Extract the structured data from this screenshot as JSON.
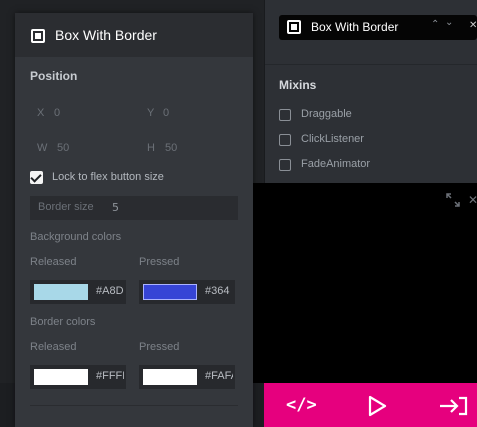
{
  "colors": {
    "accent_pink": "#e6007e",
    "released_bg": "#a8d8e8",
    "pressed_bg": "#3644d6",
    "released_border": "#ffffff",
    "pressed_border": "#ffffff"
  },
  "header": {
    "title": "Box With Border",
    "icon": "square-widget-icon",
    "chevron_up": "⌃",
    "chevron_down": "⌄",
    "close": "✕"
  },
  "mixins": {
    "title": "Mixins",
    "items": [
      {
        "label": "Draggable",
        "checked": false
      },
      {
        "label": "ClickListener",
        "checked": false
      },
      {
        "label": "FadeAnimator",
        "checked": false
      }
    ]
  },
  "panel": {
    "title": "Box With Border",
    "position": {
      "title": "Position",
      "x_label": "X",
      "x_value": "0",
      "y_label": "Y",
      "y_value": "0",
      "w_label": "W",
      "w_value": "50",
      "h_label": "H",
      "h_value": "50"
    },
    "lock": {
      "label": "Lock to flex button size",
      "checked": true
    },
    "border_size": {
      "label": "Border size",
      "value": "5"
    },
    "background": {
      "title": "Background colors",
      "released_label": "Released",
      "pressed_label": "Pressed",
      "released_hex": "#A8D",
      "pressed_hex": "#364"
    },
    "border": {
      "title": "Border colors",
      "released_label": "Released",
      "pressed_label": "Pressed",
      "released_hex": "#FFFF",
      "pressed_hex": "#FAFA"
    }
  },
  "toolbar": {
    "code_icon": "</>",
    "play_icon": "play-icon",
    "exit_icon": "exit-icon"
  }
}
